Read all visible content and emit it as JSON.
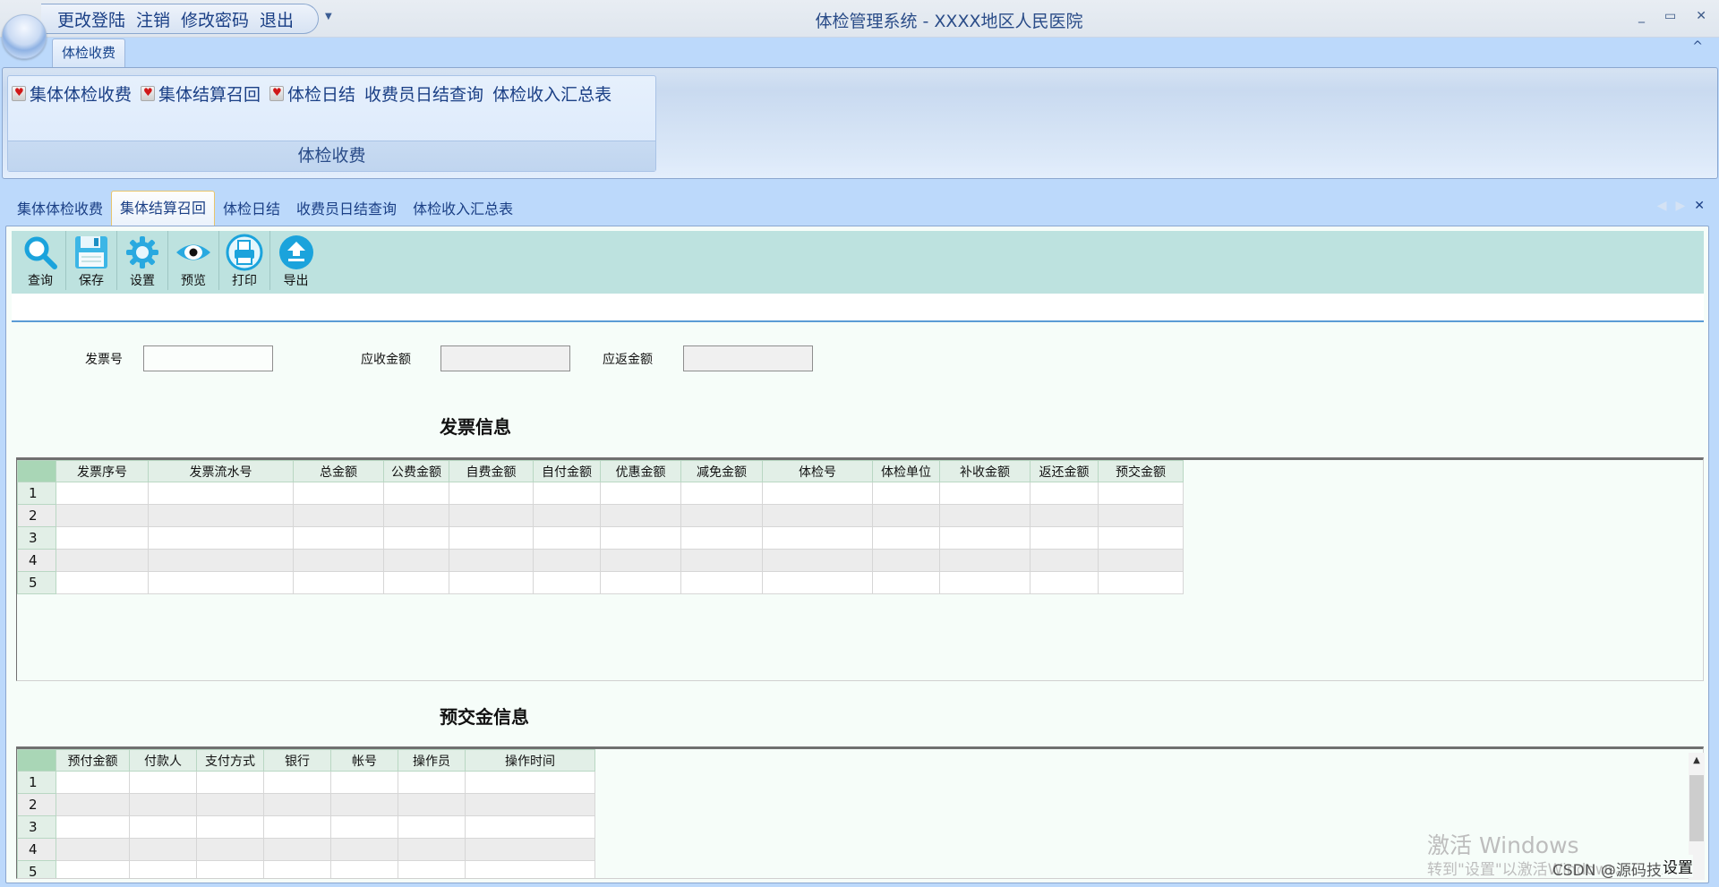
{
  "titlebar": {
    "quick_access": [
      "更改登陆",
      "注销",
      "修改密码",
      "退出"
    ],
    "app_title": "体检管理系统   -  XXXX地区人民医院",
    "window_controls": {
      "minimize": "_",
      "maximize": "▭",
      "close": "✕"
    }
  },
  "ribbon": {
    "tab": "体检收费",
    "collapse_icon": "^",
    "group_label": "体检收费",
    "items": [
      {
        "label": "集体体检收费",
        "icon": "heart-icon"
      },
      {
        "label": "集体结算召回",
        "icon": "heart-icon"
      },
      {
        "label": "体检日结",
        "icon": "heart-icon"
      },
      {
        "label": "收费员日结查询",
        "icon": ""
      },
      {
        "label": "体检收入汇总表",
        "icon": ""
      }
    ]
  },
  "doc_tabs": {
    "tabs": [
      "集体体检收费",
      "集体结算召回",
      "体检日结",
      "收费员日结查询",
      "体检收入汇总表"
    ],
    "active_index": 1,
    "nav_prev": "◀",
    "nav_next": "▶",
    "close": "✕"
  },
  "toolbar": {
    "buttons": [
      {
        "label": "查询",
        "icon": "search-icon"
      },
      {
        "label": "保存",
        "icon": "save-icon"
      },
      {
        "label": "设置",
        "icon": "gear-icon"
      },
      {
        "label": "预览",
        "icon": "eye-icon"
      },
      {
        "label": "打印",
        "icon": "printer-icon"
      },
      {
        "label": "导出",
        "icon": "export-icon"
      }
    ]
  },
  "form": {
    "invoice_no": {
      "label": "发票号",
      "value": ""
    },
    "receivable": {
      "label": "应收金额",
      "value": ""
    },
    "refundable": {
      "label": "应返金额",
      "value": ""
    }
  },
  "invoice_section": {
    "title": "发票信息",
    "columns": [
      "发票序号",
      "发票流水号",
      "总金额",
      "公费金额",
      "自费金额",
      "自付金额",
      "优惠金额",
      "减免金额",
      "体检号",
      "体检单位",
      "补收金额",
      "返还金额",
      "预交金额"
    ],
    "rows": [
      "1",
      "2",
      "3",
      "4",
      "5"
    ]
  },
  "prepay_section": {
    "title": "预交金信息",
    "columns": [
      "预付金额",
      "付款人",
      "支付方式",
      "银行",
      "帐号",
      "操作员",
      "操作时间"
    ],
    "rows": [
      "1",
      "2",
      "3",
      "4",
      "5"
    ]
  },
  "watermark": {
    "line1": "激活 Windows",
    "line2": "转到\"设置\"以激活Windows。",
    "credit": "CSDN @源码技术栈",
    "settings": "设置"
  }
}
